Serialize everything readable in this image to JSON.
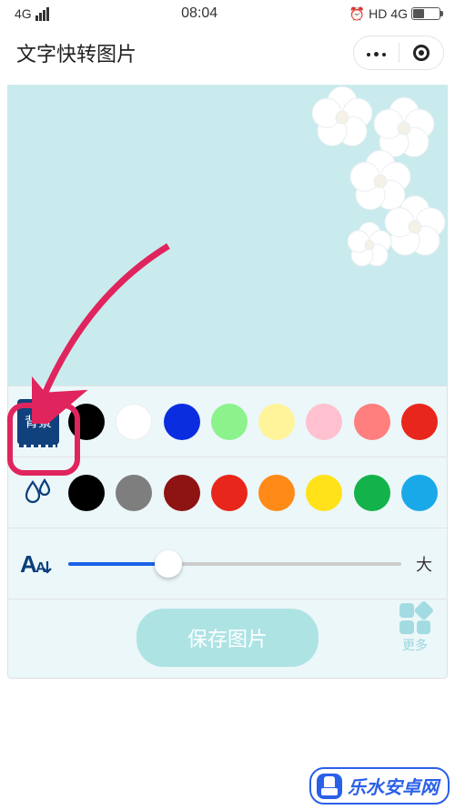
{
  "status": {
    "net": "4G",
    "time": "08:04",
    "hd": "HD",
    "net2": "4G"
  },
  "header": {
    "title": "文字快转图片"
  },
  "tools": {
    "bg_label": "背景",
    "bg_swatches": [
      "#000000",
      "#ffffff",
      "#0b2de0",
      "#8cf28c",
      "#fff49a",
      "#ffc1d0",
      "#ff7e7e",
      "#e8261c"
    ],
    "fg_swatches": [
      "#000000",
      "#7e7e7e",
      "#8e1313",
      "#e8261c",
      "#ff8a17",
      "#ffe21a",
      "#14b24a",
      "#1aa9e8"
    ],
    "size_label": "大",
    "slider_percent": 30
  },
  "actions": {
    "save": "保存图片",
    "more": "更多"
  },
  "watermark": "乐水安卓网"
}
